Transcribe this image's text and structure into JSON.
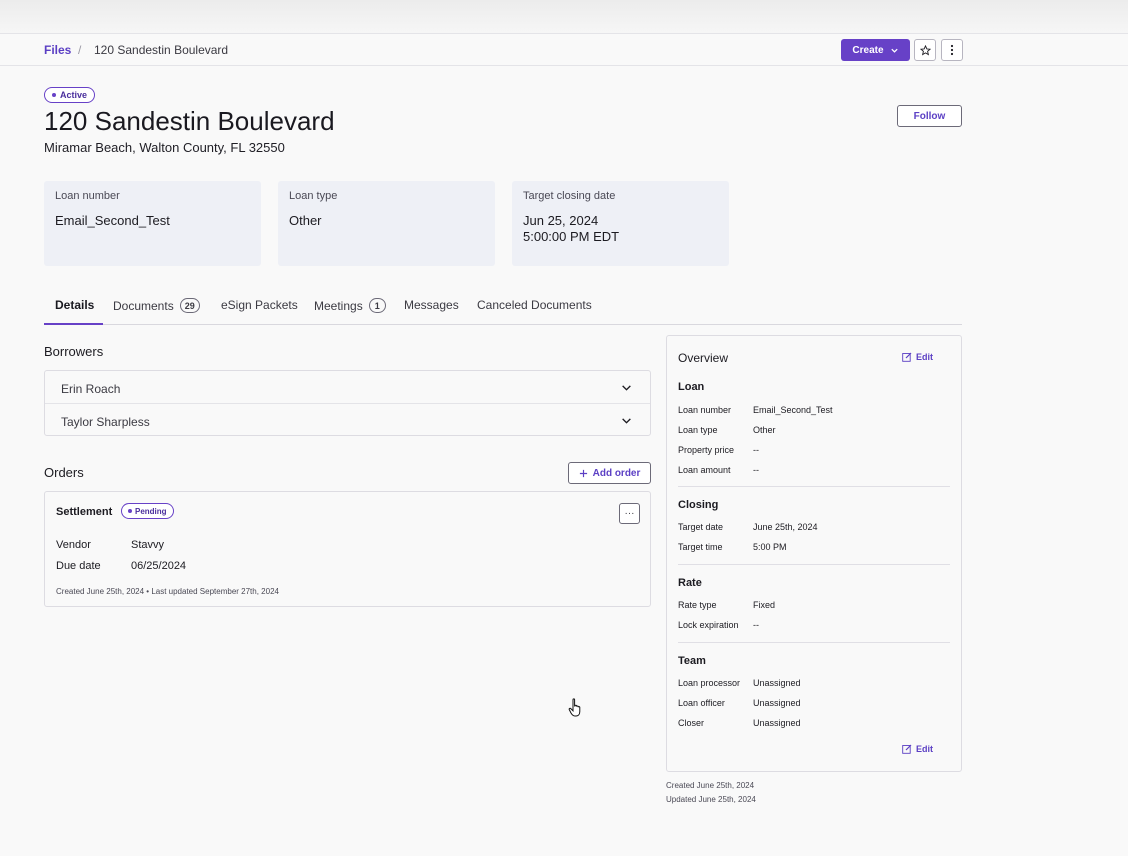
{
  "breadcrumb": {
    "root": "Files",
    "separator": "/",
    "current": "120 Sandestin Boulevard"
  },
  "toolbar": {
    "create_label": "Create"
  },
  "status": {
    "label": "Active"
  },
  "header": {
    "title": "120 Sandestin Boulevard",
    "address": "Miramar Beach, Walton County, FL 32550",
    "follow_label": "Follow"
  },
  "cards": [
    {
      "label": "Loan number",
      "value": "Email_Second_Test"
    },
    {
      "label": "Loan type",
      "value": "Other"
    },
    {
      "label": "Target closing date",
      "value": "Jun 25, 2024",
      "value2": "5:00:00 PM EDT"
    }
  ],
  "tabs": [
    {
      "label": "Details"
    },
    {
      "label": "Documents",
      "count": "29"
    },
    {
      "label": "eSign Packets"
    },
    {
      "label": "Meetings",
      "count": "1"
    },
    {
      "label": "Messages"
    },
    {
      "label": "Canceled Documents"
    }
  ],
  "borrowers": {
    "heading": "Borrowers",
    "items": [
      {
        "name": "Erin Roach"
      },
      {
        "name": "Taylor Sharpless"
      }
    ]
  },
  "orders": {
    "heading": "Orders",
    "add_label": "Add order",
    "items": [
      {
        "title": "Settlement",
        "status": "Pending",
        "more": "···",
        "vendor_label": "Vendor",
        "vendor": "Stavvy",
        "due_label": "Due date",
        "due": "06/25/2024",
        "meta": "Created June 25th, 2024 • Last updated September 27th, 2024"
      }
    ]
  },
  "overview": {
    "title": "Overview",
    "edit_label": "Edit",
    "sections": [
      {
        "heading": "Loan",
        "rows": [
          {
            "k": "Loan number",
            "v": "Email_Second_Test"
          },
          {
            "k": "Loan type",
            "v": "Other"
          },
          {
            "k": "Property price",
            "v": "--"
          },
          {
            "k": "Loan amount",
            "v": "--"
          }
        ]
      },
      {
        "heading": "Closing",
        "rows": [
          {
            "k": "Target date",
            "v": "June 25th, 2024"
          },
          {
            "k": "Target time",
            "v": "5:00 PM"
          }
        ]
      },
      {
        "heading": "Rate",
        "rows": [
          {
            "k": "Rate type",
            "v": "Fixed"
          },
          {
            "k": "Lock expiration",
            "v": "--"
          }
        ]
      },
      {
        "heading": "Team",
        "rows": [
          {
            "k": "Loan processor",
            "v": "Unassigned"
          },
          {
            "k": "Loan officer",
            "v": "Unassigned"
          },
          {
            "k": "Closer",
            "v": "Unassigned"
          }
        ]
      }
    ],
    "bottom_edit_label": "Edit"
  },
  "footer": {
    "created": "Created June 25th, 2024",
    "updated": "Updated June 25th, 2024"
  },
  "colors": {
    "accent": "#6741c7",
    "card_bg": "#eef0f6",
    "page_bg": "#f9f9f9"
  }
}
